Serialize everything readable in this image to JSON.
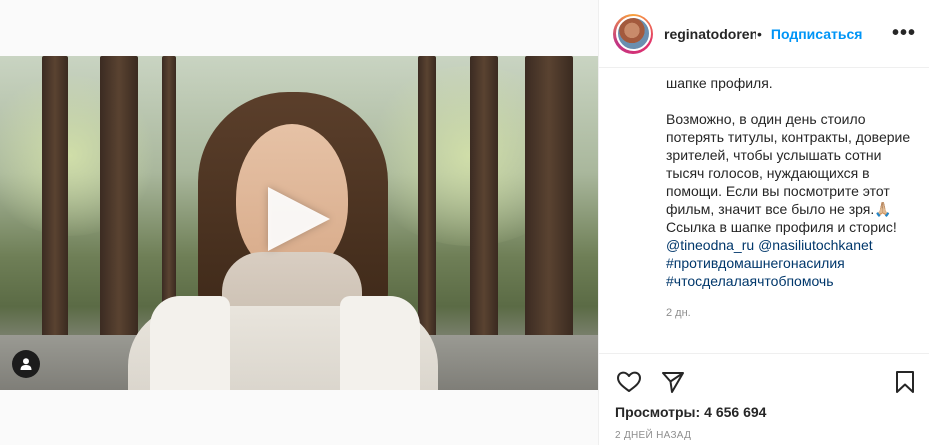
{
  "post": {
    "author": {
      "username": "reginatodorenko",
      "separator": "•",
      "follow_label": "Подписаться",
      "more_icon": "more-horizontal-icon"
    },
    "caption_lines": [
      "шапке профиля.",
      "",
      "Возможно, в один день стоило",
      "потерять титулы, контракты, доверие",
      "зрителей, чтобы услышать сотни",
      "тысяч голосов, нуждающихся в",
      "помощи. Если вы посмотрите этот",
      "фильм, значит все было не зря.🙏🏼",
      "Ссылка в шапке профиля и сторис!"
    ],
    "mentions": [
      "@tineodna_ru",
      "@nasiliutochkanet"
    ],
    "hashtags": [
      "#противдомашнегонасилия",
      "#чтосделалаячтобпомочь"
    ],
    "caption_time": "2 дн.",
    "views_label": "Просмотры:",
    "views_count": "4 656 694",
    "date": "2 ДНЕЙ НАЗАД",
    "actions": {
      "like_icon": "heart-icon",
      "share_icon": "send-icon",
      "save_icon": "bookmark-icon"
    }
  },
  "media": {
    "type": "video",
    "play_icon": "play-icon",
    "tag_icon": "user-tag-icon"
  }
}
